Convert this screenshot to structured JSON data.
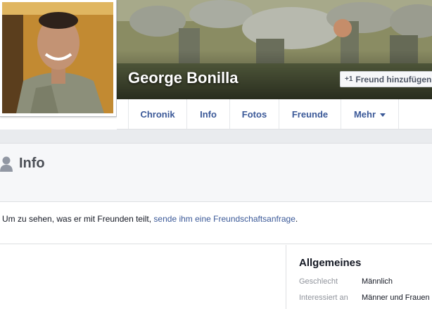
{
  "profile": {
    "name": "George Bonilla",
    "add_friend_label": "Freund hinzufügen",
    "add_friend_icon": "+1"
  },
  "nav": {
    "tabs": [
      {
        "label": "Chronik"
      },
      {
        "label": "Info"
      },
      {
        "label": "Fotos"
      },
      {
        "label": "Freunde"
      },
      {
        "label": "Mehr"
      }
    ]
  },
  "info": {
    "title": "Info",
    "message_prefix": "Um zu sehen, was er mit Freunden teilt, ",
    "message_link": "sende ihm eine Freundschaftsanfrage",
    "message_suffix": "."
  },
  "general": {
    "title": "Allgemeines",
    "rows": [
      {
        "label": "Geschlecht",
        "value": "Männlich"
      },
      {
        "label": "Interessiert an",
        "value": "Männer und Frauen"
      }
    ]
  },
  "colors": {
    "link": "#3b5998",
    "header_bg": "#f6f7f9",
    "page_bg": "#e9ebee"
  }
}
